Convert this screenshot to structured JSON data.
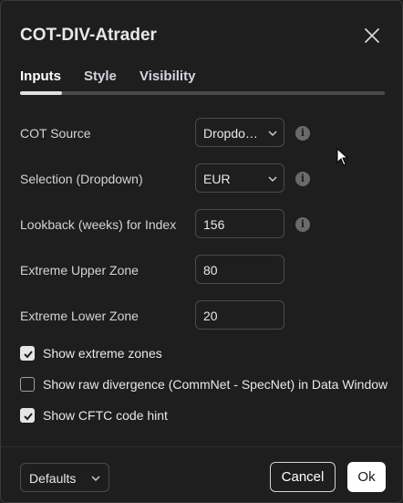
{
  "dialog": {
    "title": "COT-DIV-Atrader",
    "close_icon": "close-icon"
  },
  "tabs": [
    {
      "label": "Inputs",
      "active": true
    },
    {
      "label": "Style",
      "active": false
    },
    {
      "label": "Visibility",
      "active": false
    }
  ],
  "inputs": {
    "cot_source": {
      "label": "COT Source",
      "value": "Dropdo…",
      "type": "dropdown",
      "info": true
    },
    "selection": {
      "label": "Selection (Dropdown)",
      "value": "EUR",
      "type": "dropdown",
      "info": true
    },
    "lookback": {
      "label": "Lookback (weeks) for Index",
      "value": "156",
      "type": "number",
      "info": true
    },
    "upper_zone": {
      "label": "Extreme Upper Zone",
      "value": "80",
      "type": "number"
    },
    "lower_zone": {
      "label": "Extreme Lower Zone",
      "value": "20",
      "type": "number"
    }
  },
  "checkboxes": [
    {
      "label": "Show extreme zones",
      "checked": true
    },
    {
      "label": "Show raw divergence (CommNet - SpecNet) in Data Window",
      "checked": false
    },
    {
      "label": "Show CFTC code hint",
      "checked": true
    }
  ],
  "footer": {
    "defaults_label": "Defaults",
    "cancel_label": "Cancel",
    "ok_label": "Ok"
  },
  "info_glyph": "i",
  "colors": {
    "background": "#1e1e1e",
    "border": "#4a4a4a",
    "text": "#d1d4dc",
    "ok_button": "#ffffff"
  }
}
